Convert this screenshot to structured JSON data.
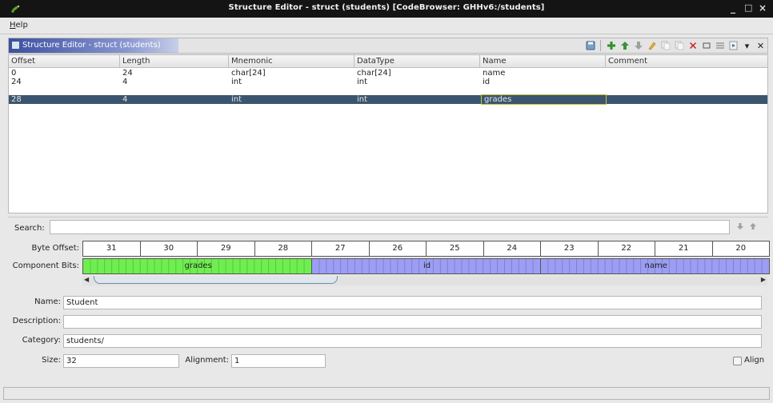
{
  "window": {
    "title": "Structure Editor - struct (students) [CodeBrowser: GHHv6:/students]",
    "minimize": "_",
    "maximize": "□",
    "close": "×"
  },
  "menu": {
    "help_prefix": "H",
    "help_rest": "elp"
  },
  "panel": {
    "title": "Structure Editor - struct (students)"
  },
  "toolbar": {
    "icons": [
      "save-icon",
      "add-icon",
      "move-up-icon",
      "move-down-icon",
      "edit-icon",
      "duplicate-icon",
      "duplicate-multiple-icon",
      "delete-icon",
      "clear-icon",
      "pack-icon",
      "unpack-icon",
      "dropdown-icon",
      "close-icon"
    ],
    "dropdown": "▾",
    "close": "✕",
    "accent_green": "#2f8f2f",
    "accent_red": "#c21d1d"
  },
  "table": {
    "columns": [
      "Offset",
      "Length",
      "Mnemonic",
      "DataType",
      "Name",
      "Comment"
    ],
    "rows": [
      [
        "0",
        "24",
        "char[24]",
        "char[24]",
        "name",
        ""
      ],
      [
        "24",
        "4",
        "int",
        "int",
        "id",
        ""
      ],
      [
        "28",
        "4",
        "int",
        "int",
        "grades",
        ""
      ]
    ],
    "selected_row": 2,
    "selection_color": "#3b556e"
  },
  "search": {
    "label": "Search:",
    "value": "",
    "placeholder": ""
  },
  "bitview": {
    "byte_offset_label": "Byte Offset:",
    "component_bits_label": "Component Bits:",
    "offsets": [
      "31",
      "30",
      "29",
      "28",
      "27",
      "26",
      "25",
      "24",
      "23",
      "22",
      "21",
      "20"
    ],
    "components": [
      {
        "name": "grades",
        "bytes": 4,
        "color": "#6fef4f"
      },
      {
        "name": "id",
        "bytes": 4,
        "color": "#9c9ef5"
      },
      {
        "name": "name",
        "bytes": 4,
        "color": "#9c9ef5"
      }
    ]
  },
  "form": {
    "name_label": "Name:",
    "name_value": "Student",
    "description_label": "Description:",
    "description_value": "",
    "category_label": "Category:",
    "category_value": "students/",
    "size_label": "Size:",
    "size_value": "32",
    "alignment_label": "Alignment:",
    "alignment_value": "1",
    "align_label": "Align"
  }
}
